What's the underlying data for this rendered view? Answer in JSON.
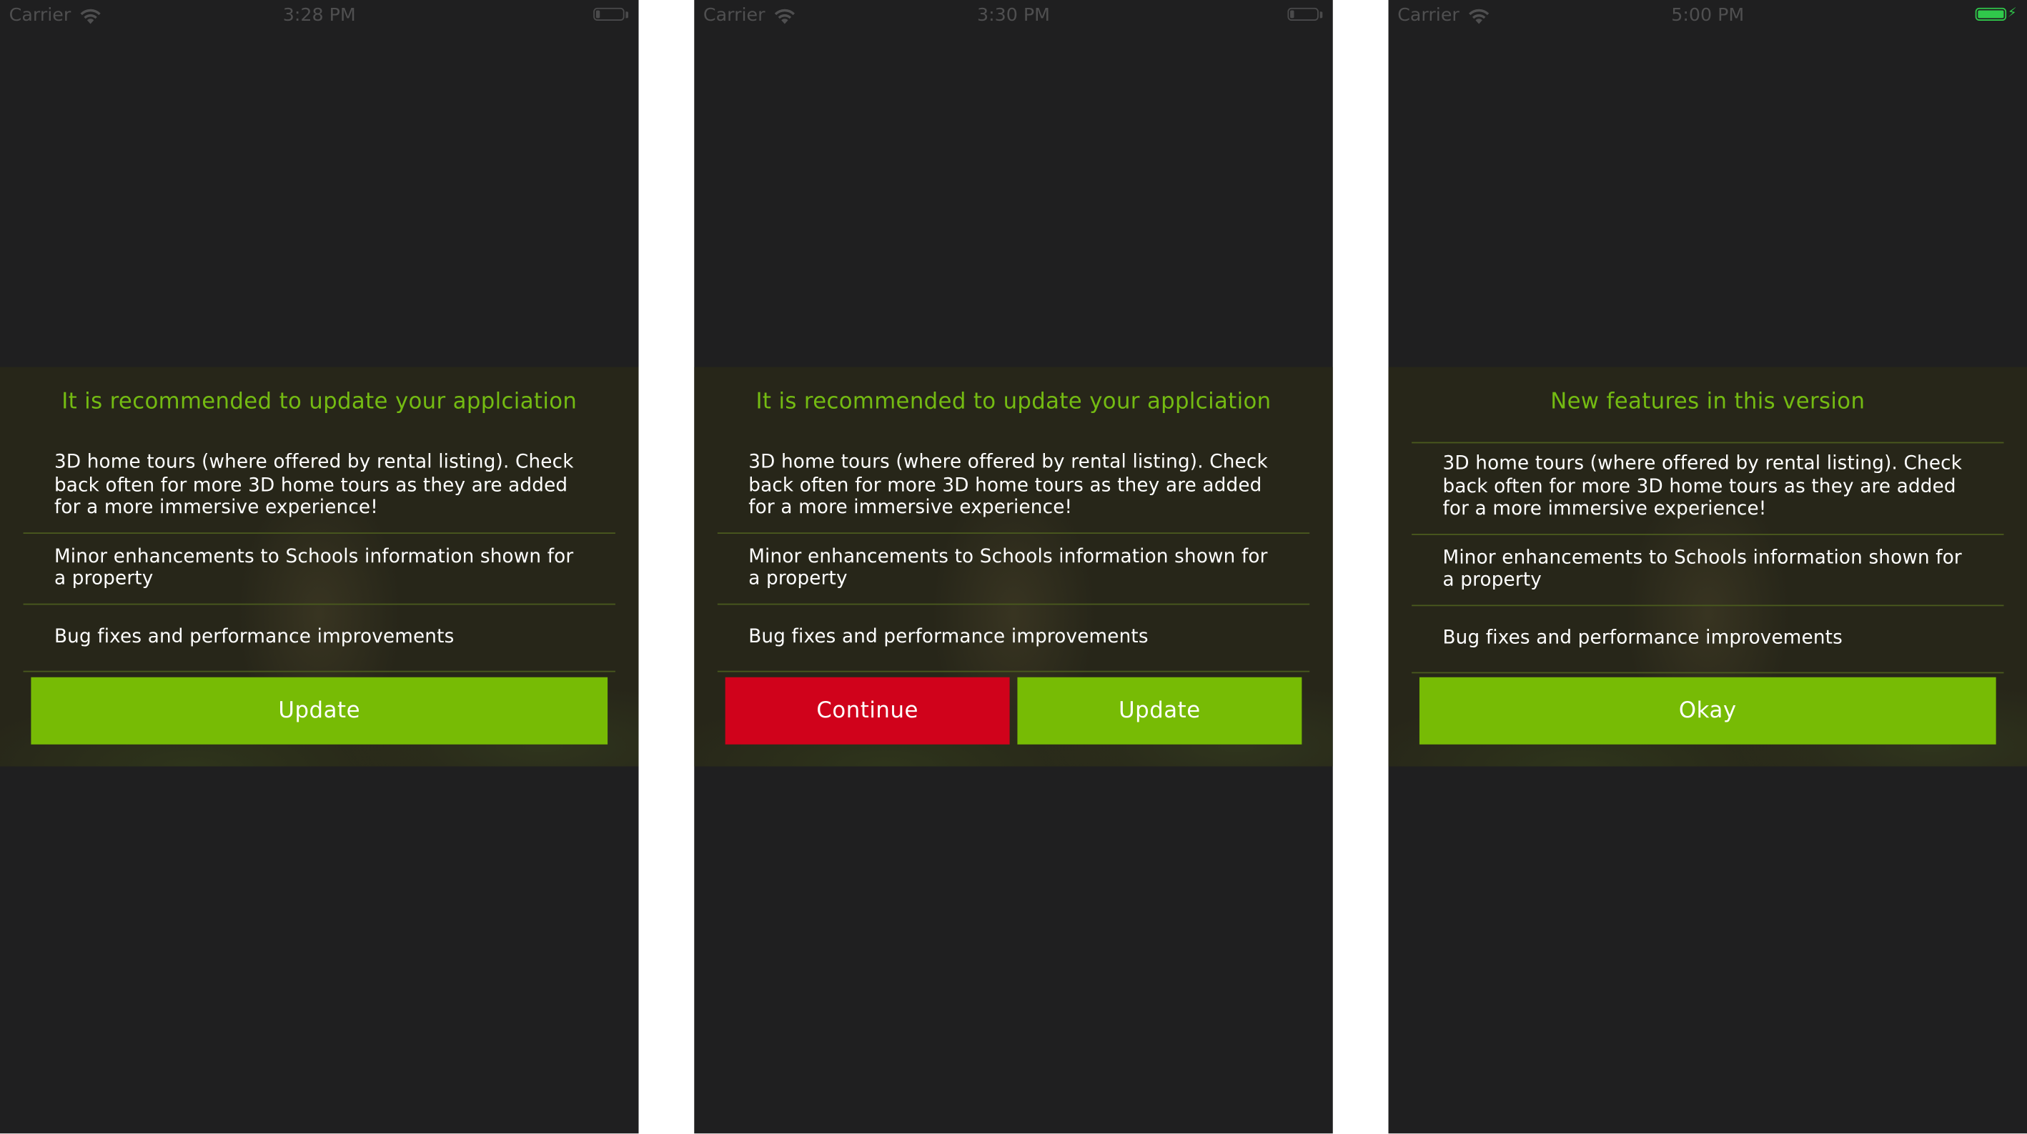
{
  "screens": [
    {
      "status": {
        "carrier": "Carrier",
        "time": "3:28 PM",
        "battery_level": 0.12,
        "charging": false
      },
      "dialog": {
        "title": "It is recommended to update your applciation",
        "items": [
          "3D home tours (where offered by rental listing). Check back often for more 3D home tours as they are added for a more immersive experience!",
          "Minor enhancements to Schools information shown for a property",
          "Bug fixes and performance improvements"
        ],
        "buttons": [
          {
            "label": "Update",
            "style": "green"
          }
        ]
      }
    },
    {
      "status": {
        "carrier": "Carrier",
        "time": "3:30 PM",
        "battery_level": 0.12,
        "charging": false
      },
      "dialog": {
        "title": "It is recommended to update your applciation",
        "items": [
          "3D home tours (where offered by rental listing). Check back often for more 3D home tours as they are added for a more immersive experience!",
          "Minor enhancements to Schools information shown for a property",
          "Bug fixes and performance improvements"
        ],
        "buttons": [
          {
            "label": "Continue",
            "style": "red"
          },
          {
            "label": "Update",
            "style": "green"
          }
        ]
      }
    },
    {
      "status": {
        "carrier": "Carrier",
        "time": "5:00 PM",
        "battery_level": 1.0,
        "charging": true
      },
      "dialog": {
        "title": "New features in this version",
        "items": [
          "3D home tours (where offered by rental listing). Check back often for more 3D home tours as they are added for a more immersive experience!",
          "Minor enhancements to Schools information shown for a property",
          "Bug fixes and performance improvements"
        ],
        "buttons": [
          {
            "label": "Okay",
            "style": "green"
          }
        ]
      }
    }
  ],
  "colors": {
    "screen_background": "#1f1f20",
    "title_green": "#74bb12",
    "button_green": "#77bb05",
    "button_red": "#d0021b",
    "battery_green": "#30c84b"
  },
  "icons": {
    "signal": "wifi-icon",
    "battery": "battery-icon",
    "charging": "bolt-icon"
  }
}
